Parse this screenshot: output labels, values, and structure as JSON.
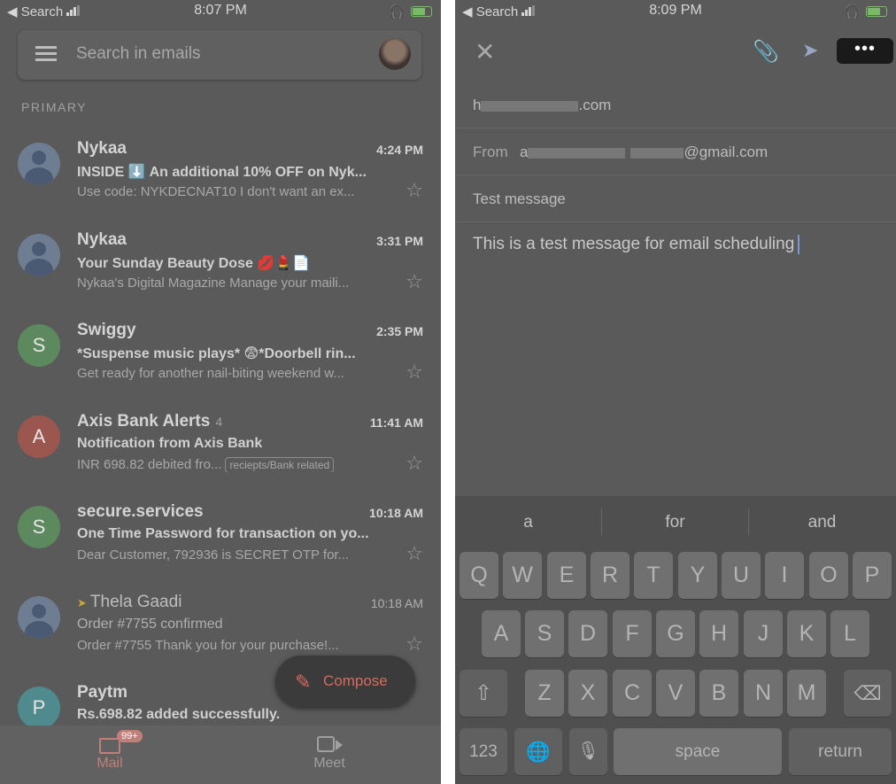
{
  "left": {
    "status": {
      "back": "◀ Search",
      "time": "8:07 PM"
    },
    "search_placeholder": "Search in emails",
    "section": "PRIMARY",
    "emails": [
      {
        "sender": "Nykaa",
        "time": "4:24 PM",
        "subject": "INSIDE ⬇️ An additional 10% OFF on Nyk...",
        "snippet": "Use code: NYKDECNAT10 I don't want an ex..."
      },
      {
        "sender": "Nykaa",
        "time": "3:31 PM",
        "subject": "Your Sunday Beauty Dose 💋💄📄",
        "snippet": "Nykaa's Digital Magazine Manage your maili..."
      },
      {
        "sender": "Swiggy",
        "initial": "S",
        "time": "2:35 PM",
        "subject": "*Suspense music plays* 😨*Doorbell rin...",
        "snippet": "Get ready for another nail-biting weekend w..."
      },
      {
        "sender": "Axis Bank Alerts",
        "count": "4",
        "initial": "A",
        "time": "11:41 AM",
        "subject": "Notification from Axis Bank",
        "snippet": "INR 698.82 debited fro...",
        "tag": "reciepts/Bank related"
      },
      {
        "sender": "secure.services",
        "initial": "S",
        "time": "10:18 AM",
        "subject": "One Time Password for transaction on yo...",
        "snippet": "Dear Customer, 792936 is SECRET OTP for..."
      },
      {
        "sender": "Thela Gaadi",
        "time": "10:18 AM",
        "subject": "Order #7755 confirmed",
        "snippet": "Order #7755 Thank you for your purchase!..."
      },
      {
        "sender": "Paytm",
        "initial": "P",
        "subject": "Rs.698.82 added successfully."
      }
    ],
    "compose_label": "Compose",
    "nav": {
      "mail": "Mail",
      "mail_badge": "99+",
      "meet": "Meet"
    }
  },
  "right": {
    "status": {
      "back": "◀ Search",
      "time": "8:09 PM"
    },
    "more_label": "•••",
    "to_prefix": "h",
    "to_suffix": ".com",
    "from_label": "From",
    "from_prefix": "a",
    "from_suffix": "@gmail.com",
    "subject": "Test message",
    "body": "This is a test message for email scheduling",
    "suggestions": [
      "a",
      "for",
      "and"
    ],
    "keys": {
      "row1": [
        "Q",
        "W",
        "E",
        "R",
        "T",
        "Y",
        "U",
        "I",
        "O",
        "P"
      ],
      "row2": [
        "A",
        "S",
        "D",
        "F",
        "G",
        "H",
        "J",
        "K",
        "L"
      ],
      "row3": [
        "Z",
        "X",
        "C",
        "V",
        "B",
        "N",
        "M"
      ],
      "numbers": "123",
      "space": "space",
      "return": "return"
    }
  },
  "colors": {
    "accent": "#d86a5e",
    "overlay": "#5a5a5a",
    "avatar_green": "#5c8a5e",
    "avatar_red": "#9c5650",
    "avatar_teal": "#4f8a8f"
  }
}
